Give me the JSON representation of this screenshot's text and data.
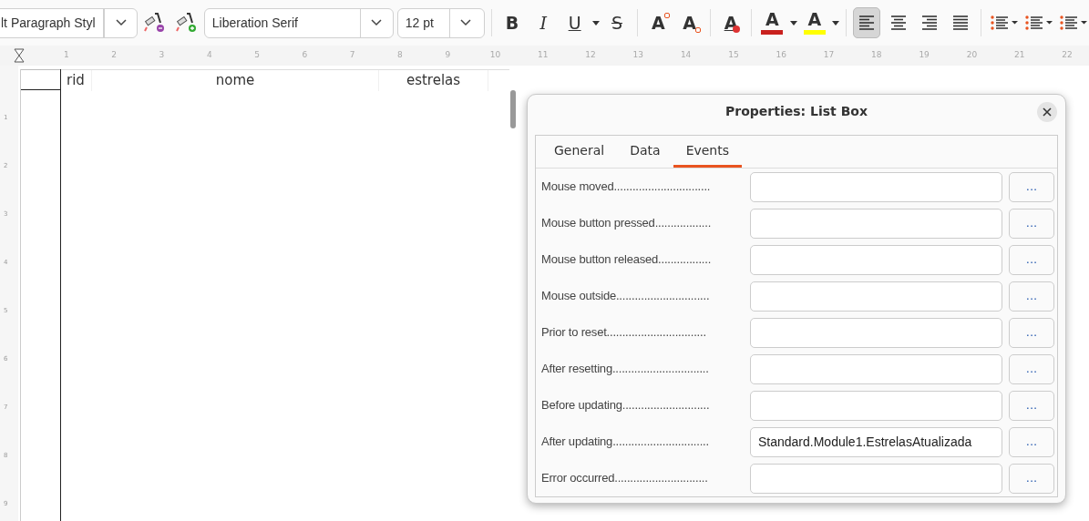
{
  "toolbar": {
    "paragraph_style": "lt Paragraph Styl",
    "font_name": "Liberation Serif",
    "font_size": "12 pt",
    "buttons": [
      {
        "kind": "bold",
        "glyph": "B",
        "selected": false
      },
      {
        "kind": "italic",
        "glyph": "I",
        "selected": false
      },
      {
        "kind": "underline",
        "glyph": "U",
        "selected": false
      },
      {
        "kind": "strike",
        "glyph": "S",
        "selected": false
      },
      {
        "kind": "superscript",
        "glyph": "A",
        "selected": false
      },
      {
        "kind": "subscript",
        "glyph": "A",
        "selected": false
      },
      {
        "kind": "clear",
        "glyph": "A",
        "selected": false
      },
      {
        "kind": "fontcolor",
        "glyph": "A",
        "selected": false
      },
      {
        "kind": "highlight",
        "glyph": "A",
        "selected": false
      },
      {
        "kind": "align-left",
        "selected": true
      },
      {
        "kind": "align-center",
        "selected": false
      },
      {
        "kind": "align-right",
        "selected": false
      },
      {
        "kind": "justify",
        "selected": false
      },
      {
        "kind": "bullets",
        "selected": false
      },
      {
        "kind": "numbering",
        "selected": false
      },
      {
        "kind": "outline",
        "selected": false
      }
    ]
  },
  "ruler": {
    "ticks": [
      "1",
      "2",
      "3",
      "4",
      "5",
      "6",
      "7",
      "8",
      "9",
      "10",
      "11",
      "12",
      "13",
      "14",
      "15",
      "16",
      "17",
      "18",
      "19",
      "20",
      "21",
      "22"
    ],
    "vertical_ticks": [
      "1",
      "2",
      "3",
      "4",
      "5",
      "6",
      "7",
      "8",
      "9"
    ]
  },
  "table_control": {
    "columns": [
      "rid",
      "nome",
      "estrelas"
    ]
  },
  "dialog": {
    "title": "Properties: List Box",
    "tabs": [
      {
        "label": "General",
        "selected": false
      },
      {
        "label": "Data",
        "selected": false
      },
      {
        "label": "Events",
        "selected": true
      }
    ],
    "events": [
      {
        "label": "Mouse moved..............................."
      },
      {
        "label": "Mouse button pressed.................."
      },
      {
        "label": "Mouse button released................."
      },
      {
        "label": "Mouse outside.............................."
      },
      {
        "label": "Prior to reset................................"
      },
      {
        "label": "After resetting..............................."
      },
      {
        "label": "Before updating............................"
      },
      {
        "label": "After updating...............................",
        "value": "Standard.Module1.EstrelasAtualizada"
      },
      {
        "label": "Error occurred.............................."
      }
    ],
    "button_label": "..."
  }
}
